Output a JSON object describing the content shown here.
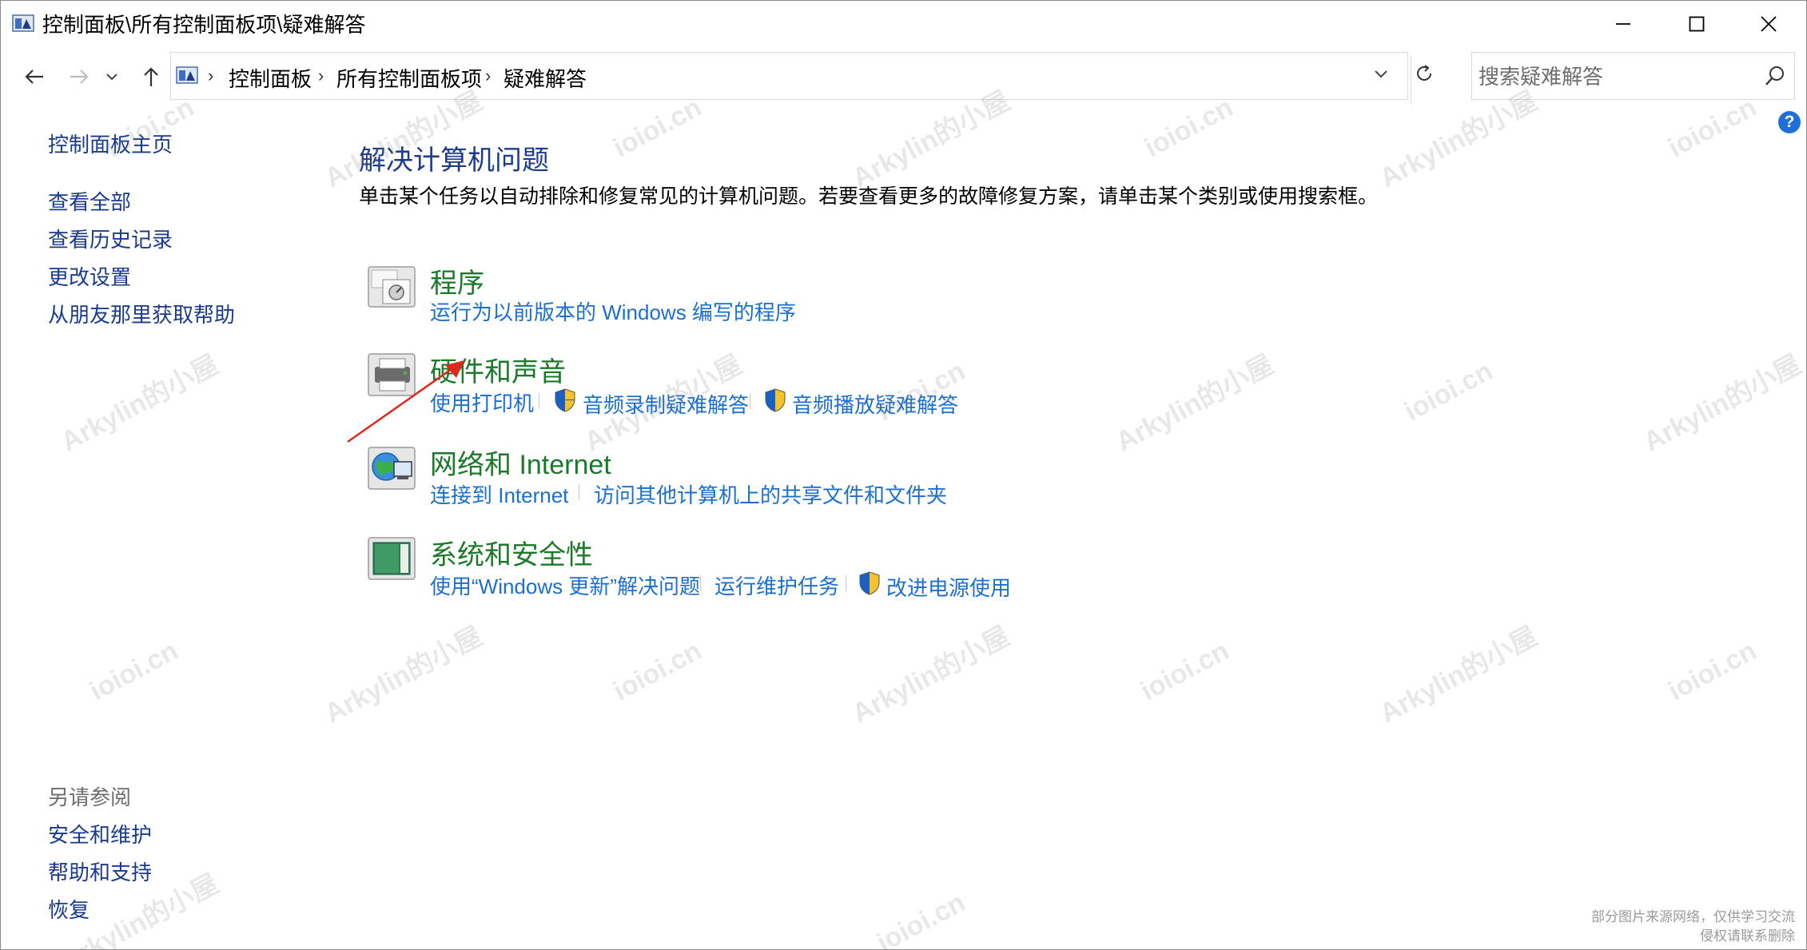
{
  "window": {
    "title": "控制面板\\所有控制面板项\\疑难解答",
    "minimize_label": "",
    "maximize_label": "",
    "close_label": ""
  },
  "address": {
    "crumbs": [
      "控制面板",
      "所有控制面板项",
      "疑难解答"
    ],
    "search_placeholder": "搜索疑难解答"
  },
  "sidebar": {
    "home": "控制面板主页",
    "links": [
      "查看全部",
      "查看历史记录",
      "更改设置",
      "从朋友那里获取帮助"
    ],
    "see_also_heading": "另请参阅",
    "see_also": [
      "安全和维护",
      "帮助和支持",
      "恢复"
    ]
  },
  "main": {
    "title": "解决计算机问题",
    "description": "单击某个任务以自动排除和修复常见的计算机问题。若要查看更多的故障修复方案，请单击某个类别或使用搜索框。",
    "categories": [
      {
        "title": "程序",
        "tasks": [
          "运行为以前版本的 Windows 编写的程序"
        ]
      },
      {
        "title": "硬件和声音",
        "tasks": [
          "使用打印机",
          "音频录制疑难解答",
          "音频播放疑难解答"
        ]
      },
      {
        "title": "网络和 Internet",
        "tasks": [
          "连接到 Internet",
          "访问其他计算机上的共享文件和文件夹"
        ]
      },
      {
        "title": "系统和安全性",
        "tasks": [
          "使用“Windows 更新”解决问题",
          "运行维护任务",
          "改进电源使用"
        ]
      }
    ]
  },
  "help": {
    "label": "?"
  },
  "watermark": {
    "text_a": "Arkylin的小屋",
    "text_b": "ioioi.cn"
  },
  "footnote": {
    "line1": "部分图片来源网络，仅供学习交流",
    "line2": "侵权请联系删除"
  },
  "colors": {
    "link": "#1a6fd0",
    "category": "#1a7a2a",
    "heading": "#1e3c8a",
    "arrow": "#e0281e"
  }
}
